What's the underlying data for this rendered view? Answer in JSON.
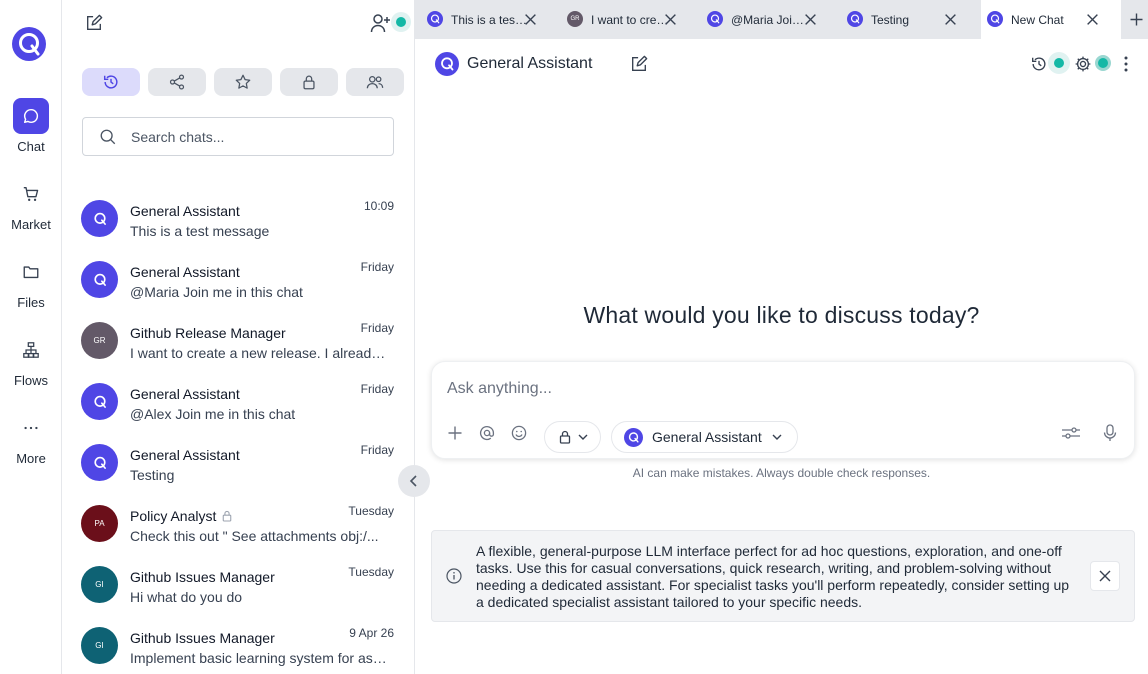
{
  "nav": {
    "logo": "q-logo",
    "items": [
      {
        "label": "Chat",
        "icon": "chat-icon",
        "active": true
      },
      {
        "label": "Market",
        "icon": "cart-icon"
      },
      {
        "label": "Files",
        "icon": "folder-icon"
      },
      {
        "label": "Flows",
        "icon": "flows-icon"
      },
      {
        "label": "More",
        "icon": "more-icon"
      }
    ]
  },
  "sidebar": {
    "filters": [
      "history-icon",
      "share-icon",
      "star-icon",
      "lock-icon",
      "group-icon"
    ],
    "search_placeholder": "Search chats...",
    "chats": [
      {
        "name": "General Assistant",
        "preview": "This is a test message",
        "time": "10:09",
        "avatar": "Q",
        "color": "#4f46e5"
      },
      {
        "name": "General Assistant",
        "preview": "@Maria Join me in this chat",
        "time": "Friday",
        "avatar": "Q",
        "color": "#4f46e5"
      },
      {
        "name": "Github Release Manager",
        "preview": "I want to create a new release. I already have the changes",
        "time": "Friday",
        "avatar": "GR",
        "color": "#635968"
      },
      {
        "name": "General Assistant",
        "preview": "@Alex Join me in this chat",
        "time": "Friday",
        "avatar": "Q",
        "color": "#4f46e5"
      },
      {
        "name": "General Assistant",
        "preview": "Testing",
        "time": "Friday",
        "avatar": "Q",
        "color": "#4f46e5"
      },
      {
        "name": "Policy Analyst",
        "preview": "Check this out \" See attachments obj:/...",
        "time": "Tuesday",
        "avatar": "PA",
        "color": "#6b0f1a",
        "locked": true
      },
      {
        "name": "Github Issues Manager",
        "preview": "Hi what do you do",
        "time": "Tuesday",
        "avatar": "GI",
        "color": "#0e6274"
      },
      {
        "name": "Github Issues Manager",
        "preview": "Implement basic learning system for assistants",
        "time": "9 Apr 26",
        "avatar": "GI",
        "color": "#0e6274"
      }
    ]
  },
  "tabs": [
    {
      "title": "This is a test message",
      "avatar": "Q",
      "color": "#4f46e5"
    },
    {
      "title": "I want to create a new release",
      "avatar": "GR",
      "color": "#635968"
    },
    {
      "title": "@Maria Join me in this chat",
      "avatar": "Q",
      "color": "#4f46e5"
    },
    {
      "title": "Testing",
      "avatar": "Q",
      "color": "#4f46e5"
    },
    {
      "title": "New Chat",
      "avatar": "Q",
      "color": "#4f46e5",
      "active": true
    }
  ],
  "main": {
    "assistant_name": "General Assistant",
    "prompt": "What would you like to discuss today?",
    "input_placeholder": "Ask anything...",
    "assistant_selector": "General Assistant",
    "disclaimer": "AI can make mistakes. Always double check responses.",
    "info_text": "A flexible, general-purpose LLM interface perfect for ad hoc questions, exploration, and one-off tasks. Use this for casual conversations, quick research, writing, and problem-solving without needing a dedicated assistant. For specialist tasks you'll perform repeatedly, consider setting up a dedicated specialist assistant tailored to your specific needs."
  },
  "colors": {
    "accent": "#4f46e5",
    "status_dot": "#14b8a6"
  }
}
